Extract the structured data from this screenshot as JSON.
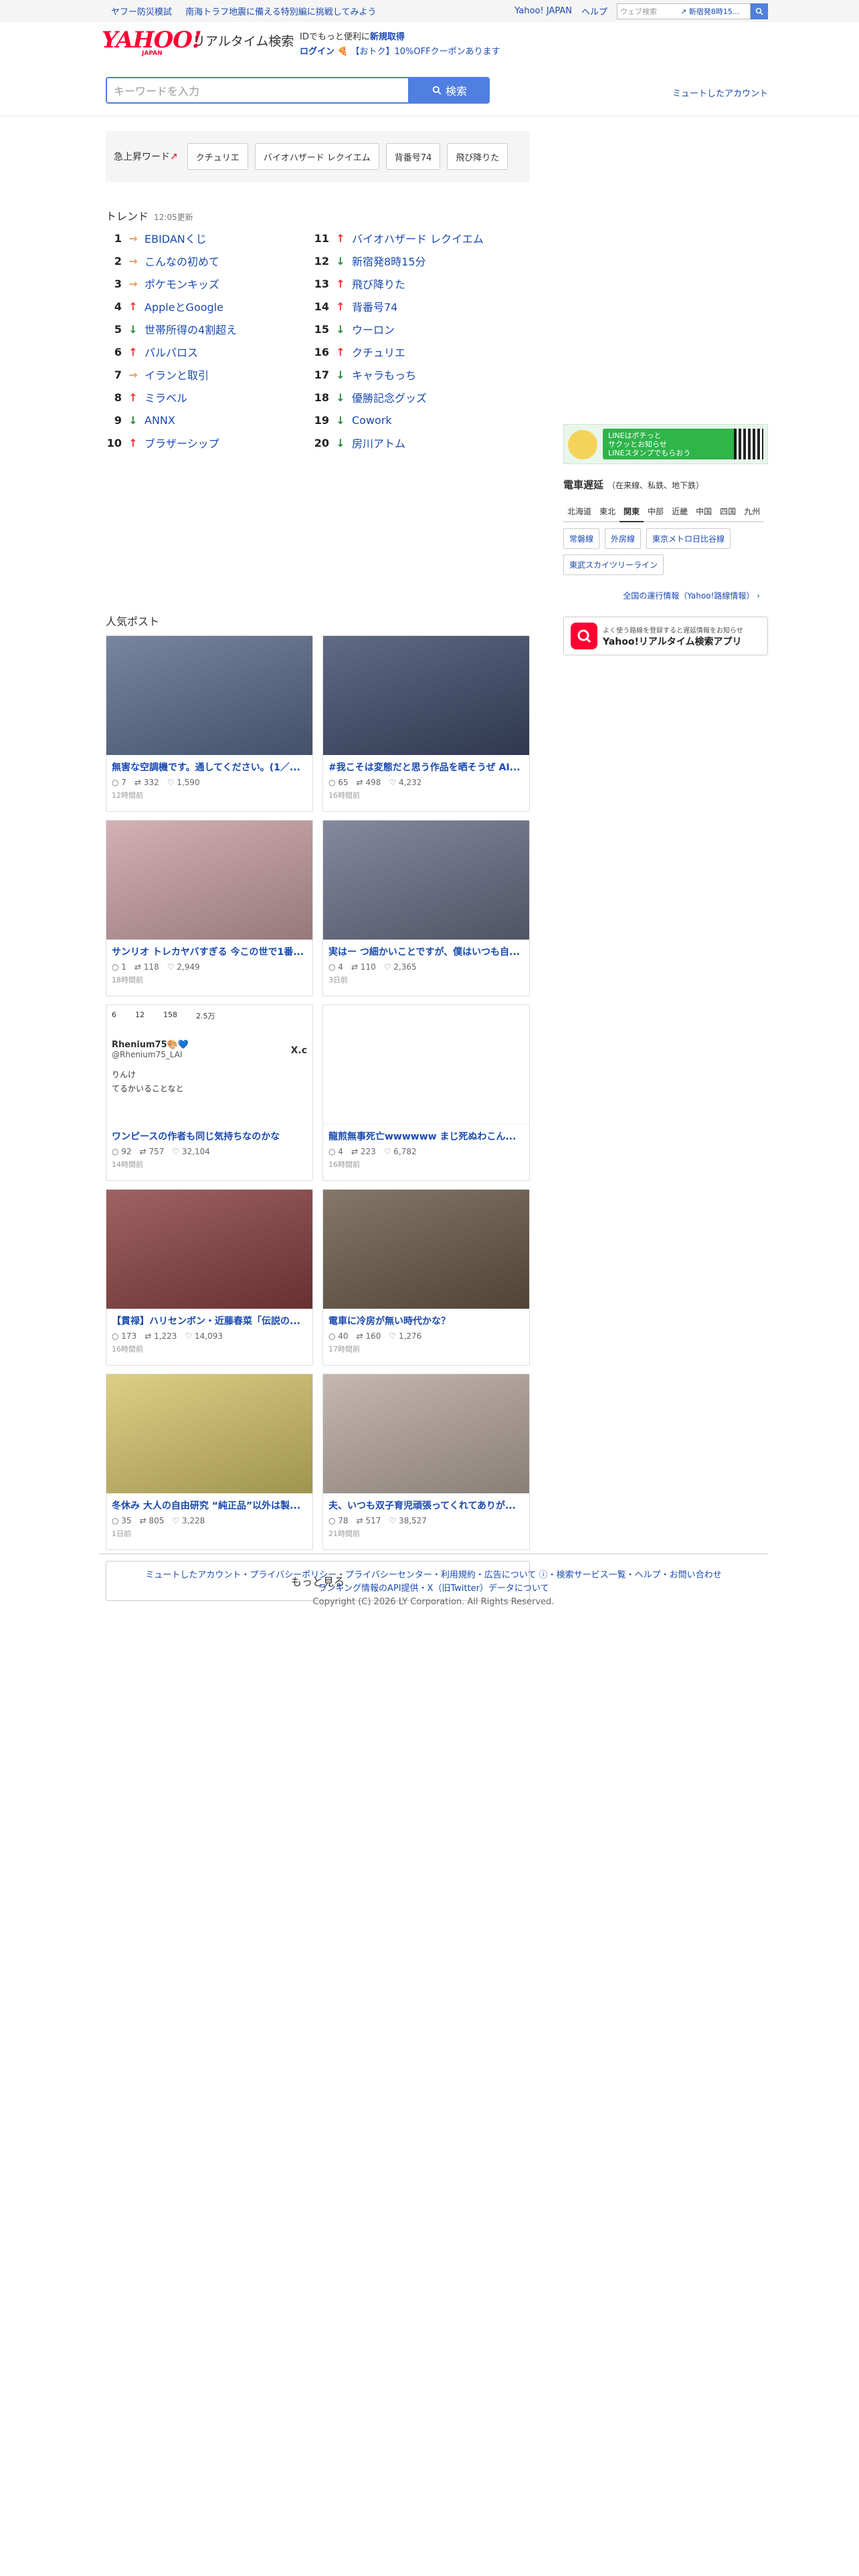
{
  "promo": {
    "items": [
      "ヤフー防災模試",
      "南海トラフ地震に備える特別編に挑戦してみよう"
    ]
  },
  "toplinks": {
    "yahoo_japan": "Yahoo! JAPAN",
    "help": "ヘルプ",
    "web_search_placeholder": "ウェブ検索",
    "web_search_suggest": "↗ 新宿発8時15..."
  },
  "header": {
    "logo_text": "YAHOO!",
    "logo_sub": "JAPAN",
    "service_name": "リアルタイム検索",
    "login_note_1": "IDでもっと便利に",
    "login_note_register": "新規取得",
    "login_label": "ログイン",
    "coupon": "【おトク】10%OFFクーポンあります"
  },
  "search": {
    "placeholder": "キーワードを入力",
    "button": "検索",
    "mute_link": "ミュートしたアカウント"
  },
  "rising": {
    "label": "急上昇ワード",
    "chips": [
      "クチュリエ",
      "バイオハザード レクイエム",
      "背番号74",
      "飛び降りた"
    ]
  },
  "trend": {
    "title": "トレンド",
    "time": "12:05更新",
    "items": [
      {
        "rank": "1",
        "dir": "right",
        "arrow": "→",
        "label": "EBIDANくじ"
      },
      {
        "rank": "2",
        "dir": "right",
        "arrow": "→",
        "label": "こんなの初めて"
      },
      {
        "rank": "3",
        "dir": "right",
        "arrow": "→",
        "label": "ポケモンキッズ"
      },
      {
        "rank": "4",
        "dir": "up",
        "arrow": "↑",
        "label": "AppleとGoogle"
      },
      {
        "rank": "5",
        "dir": "down",
        "arrow": "↓",
        "label": "世帯所得の4割超え"
      },
      {
        "rank": "6",
        "dir": "up",
        "arrow": "↑",
        "label": "パルパロス"
      },
      {
        "rank": "7",
        "dir": "right",
        "arrow": "→",
        "label": "イランと取引"
      },
      {
        "rank": "8",
        "dir": "up",
        "arrow": "↑",
        "label": "ミラベル"
      },
      {
        "rank": "9",
        "dir": "down",
        "arrow": "↓",
        "label": "ANNX"
      },
      {
        "rank": "10",
        "dir": "up",
        "arrow": "↑",
        "label": "ブラザーシップ"
      },
      {
        "rank": "11",
        "dir": "up",
        "arrow": "↑",
        "label": "バイオハザード レクイエム"
      },
      {
        "rank": "12",
        "dir": "down",
        "arrow": "↓",
        "label": "新宿発8時15分"
      },
      {
        "rank": "13",
        "dir": "up",
        "arrow": "↑",
        "label": "飛び降りた"
      },
      {
        "rank": "14",
        "dir": "up",
        "arrow": "↑",
        "label": "背番号74"
      },
      {
        "rank": "15",
        "dir": "down",
        "arrow": "↓",
        "label": "ウーロン"
      },
      {
        "rank": "16",
        "dir": "up",
        "arrow": "↑",
        "label": "クチュリエ"
      },
      {
        "rank": "17",
        "dir": "down",
        "arrow": "↓",
        "label": "キャラもっち"
      },
      {
        "rank": "18",
        "dir": "down",
        "arrow": "↓",
        "label": "優勝記念グッズ"
      },
      {
        "rank": "19",
        "dir": "down",
        "arrow": "↓",
        "label": "Cowork"
      },
      {
        "rank": "20",
        "dir": "down",
        "arrow": "↓",
        "label": "房川アトム"
      }
    ]
  },
  "posts": {
    "title": "人気ポスト",
    "items": [
      {
        "title": "無害な空調機です。通してください。(1／...",
        "replies": "7",
        "reposts": "332",
        "likes": "1,590",
        "time": "12時間前",
        "bg": "#5a6b8c"
      },
      {
        "title": "#我こそは変態だと思う作品を晒そうぜ AI...",
        "replies": "65",
        "reposts": "498",
        "likes": "4,232",
        "time": "16時間前",
        "bg": "#3e4a6a"
      },
      {
        "title": "サンリオ トレカヤバすぎる 今この世で1番...",
        "replies": "1",
        "reposts": "118",
        "likes": "2,949",
        "time": "18時間前",
        "bg": "#c9a0a6"
      },
      {
        "title": "実はー つ細かいことですが、僕はいつも自...",
        "replies": "4",
        "reposts": "110",
        "likes": "2,365",
        "time": "3日前",
        "bg": "#6a6f88"
      },
      {
        "title": "ワンピースの作者も同じ気持ちなのかな",
        "replies": "92",
        "reposts": "757",
        "likes": "32,104",
        "time": "14時間前",
        "bg": "#f3f3f3"
      },
      {
        "title": "龍煎無事死亡wwwwww まじ死ぬわこん...",
        "replies": "4",
        "reposts": "223",
        "likes": "6,782",
        "time": "16時間前",
        "bg": "#ffffff"
      },
      {
        "title": "【貫禄】ハリセンボン・近藤春菜「伝説の...",
        "replies": "173",
        "reposts": "1,223",
        "likes": "14,093",
        "time": "16時間前",
        "bg": "#8a4040"
      },
      {
        "title": "電車に冷房が無い時代かな？",
        "replies": "40",
        "reposts": "160",
        "likes": "1,276",
        "time": "17時間前",
        "bg": "#6a5a48"
      },
      {
        "title": "冬休み 大人の自由研究 “純正品”以外は製...",
        "replies": "35",
        "reposts": "805",
        "likes": "3,228",
        "time": "1日前",
        "bg": "#d6c56a"
      },
      {
        "title": "夫、いつも双子育児頑張ってくれてありが...",
        "replies": "78",
        "reposts": "517",
        "likes": "38,527",
        "time": "21時間前",
        "bg": "#b8a8a0"
      }
    ],
    "tweet_embed": {
      "replies": "6",
      "reposts": "12",
      "likes": "158",
      "views": "2.5万",
      "name": "Rhenium75🎨💙",
      "handle": "@Rhenium75_LAI",
      "brand": "X.c",
      "text1": "りんけ",
      "text2": "てるかいることなと"
    },
    "more": "もっと見る"
  },
  "sidebar": {
    "ad_line_text": "LINEはポチっと\nサクッとお知らせ\nLINEスタンプでもらおう",
    "train_title": "電車遅延",
    "train_sub": "（在来線、私鉄、地下鉄）",
    "regions": [
      "北海道",
      "東北",
      "関東",
      "中部",
      "近畿",
      "中国",
      "四国",
      "九州"
    ],
    "selected_region": "関東",
    "lines": [
      "常磐線",
      "外房線",
      "東京メトロ日比谷線",
      "東武スカイツリーライン"
    ],
    "nation_link": "全国の運行情報（Yahoo!路線情報）",
    "app_note": "よく使う路線を登録すると遅延情報をお知らせ",
    "app_name": "Yahoo!リアルタイム検索アプリ"
  },
  "footer": {
    "line1": "ミュートしたアカウント・プライバシーポリシー・プライバシーセンター・利用規約・広告について ⓘ・検索サービス一覧・ヘルプ・お問い合わせ",
    "line2": "ランキング情報のAPI提供・X（旧Twitter）データについて",
    "copyright": "Copyright (C) 2026 LY Corporation. All Rights Reserved."
  },
  "colors": {
    "accent": "#4f7fe0",
    "link": "#1a4ab0",
    "up": "#ee3333",
    "down": "#2a8a3e",
    "brand": "#ff0033"
  }
}
